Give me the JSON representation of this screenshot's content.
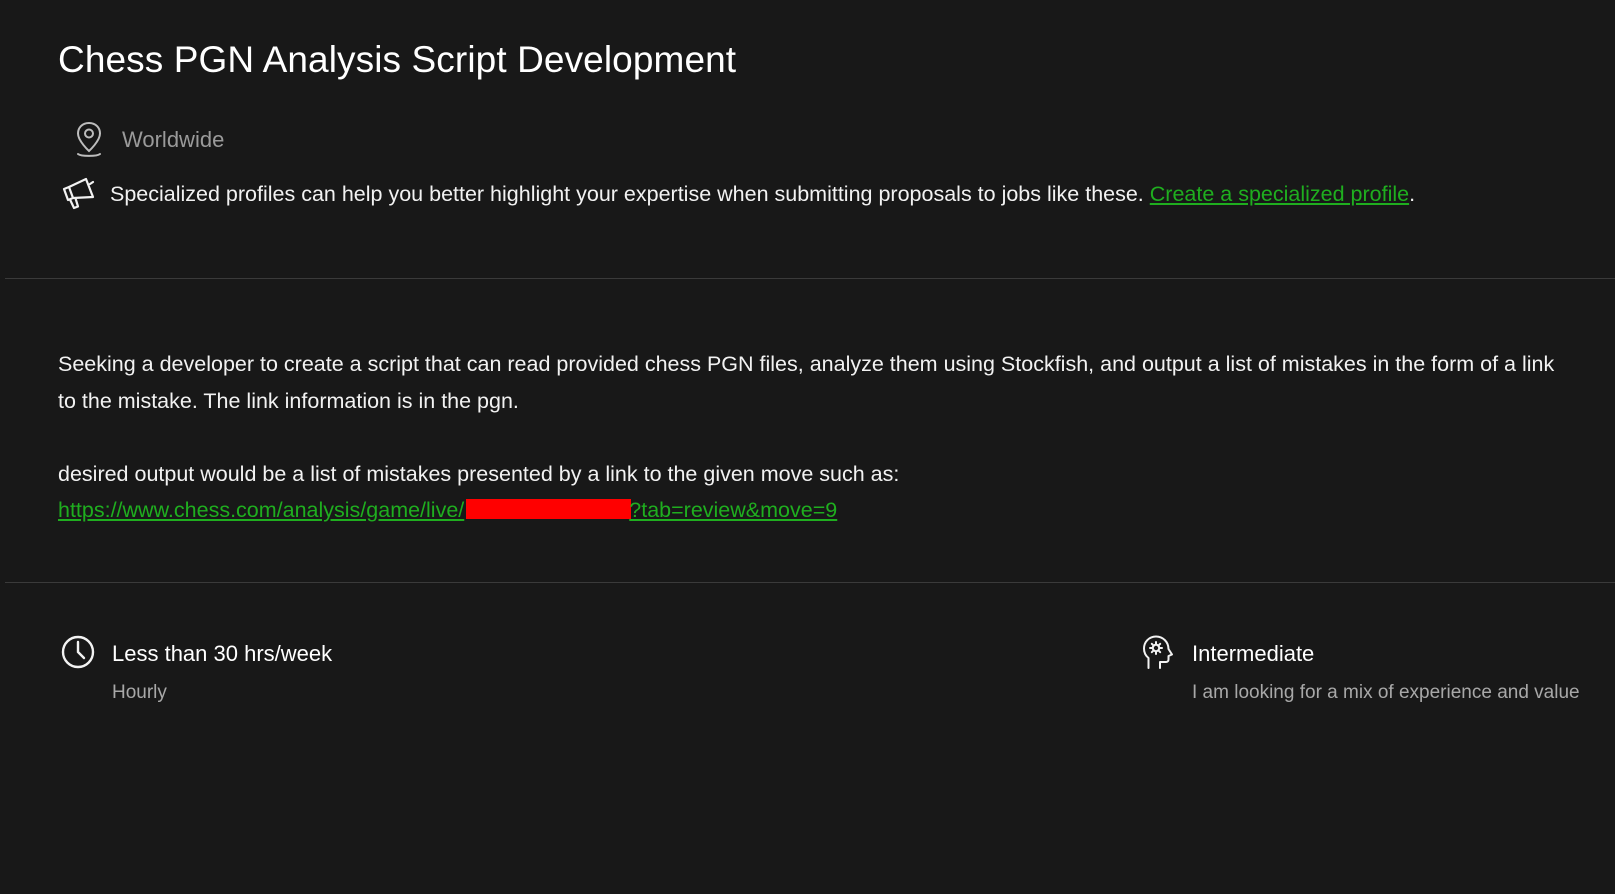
{
  "job": {
    "title": "Chess PGN Analysis Script Development",
    "location": "Worldwide",
    "location_icon": "location-pin-icon"
  },
  "promo": {
    "icon": "megaphone-icon",
    "text": "Specialized profiles can help you better highlight your expertise when submitting proposals to jobs like these. ",
    "link_label": "Create a specialized profile",
    "suffix": "."
  },
  "description": {
    "paragraph1": "Seeking a developer to create a script that can read provided chess PGN files, analyze them using Stockfish, and output a list of mistakes in the form of a link to the mistake. The link information is in the pgn.",
    "paragraph2": "desired output would be a list of mistakes presented by a link to the given move such as:",
    "link_prefix": "https://www.chess.com/analysis/game/live/",
    "link_suffix": "?tab=review&move=9"
  },
  "details": {
    "hours": {
      "icon": "clock-icon",
      "title": "Less than 30 hrs/week",
      "subtitle": "Hourly"
    },
    "experience": {
      "icon": "head-gear-icon",
      "title": "Intermediate",
      "subtitle": "I am looking for a mix of experience and value"
    }
  },
  "colors": {
    "background": "#181818",
    "link": "#1fae1f",
    "divider": "#3a3a3a",
    "redaction": "#ff0000"
  }
}
